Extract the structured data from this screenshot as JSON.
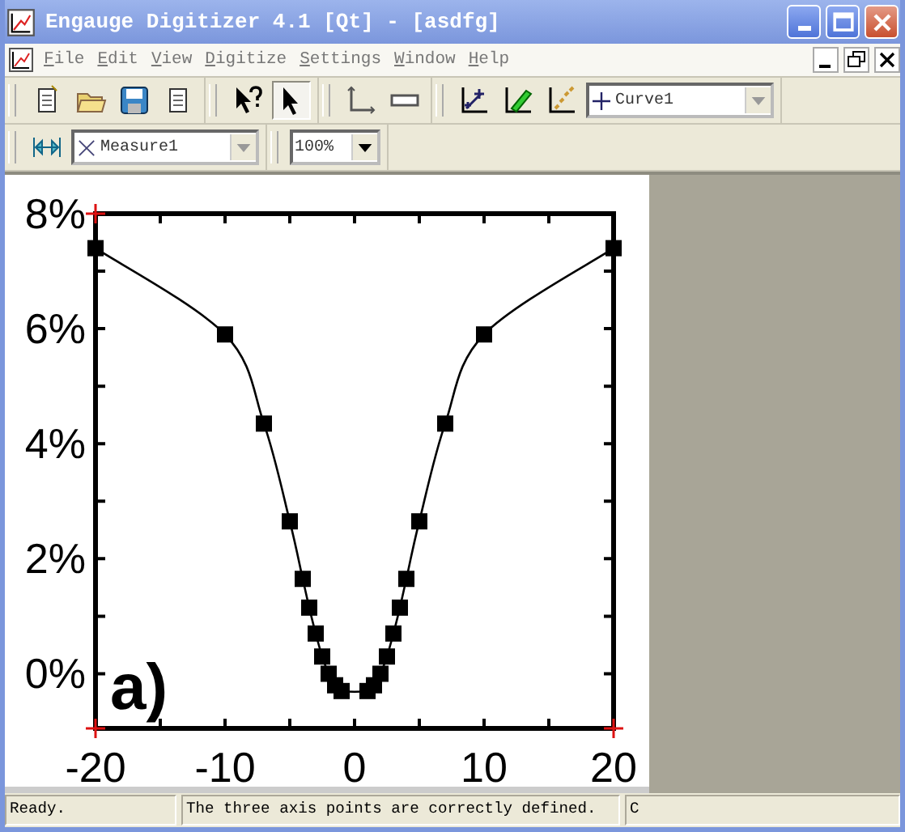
{
  "window": {
    "title": "Engauge Digitizer 4.1 [Qt] - [asdfg]"
  },
  "menu": [
    {
      "label": "File"
    },
    {
      "label": "Edit"
    },
    {
      "label": "View"
    },
    {
      "label": "Digitize"
    },
    {
      "label": "Settings"
    },
    {
      "label": "Window"
    },
    {
      "label": "Help"
    }
  ],
  "toolbar_1": [
    {
      "group": [
        {
          "kind": "new"
        },
        {
          "kind": "open"
        },
        {
          "kind": "save"
        },
        {
          "kind": "properties"
        }
      ]
    },
    {
      "group": [
        {
          "kind": "whats_this"
        },
        {
          "kind": "select",
          "selected": true
        }
      ]
    },
    {
      "group": [
        {
          "kind": "axis",
          "selected": false
        },
        {
          "kind": "scale",
          "selected": false
        }
      ]
    },
    {
      "group": [
        {
          "kind": "point",
          "selected": false
        },
        {
          "kind": "segment",
          "selected": false
        },
        {
          "kind": "match",
          "selected": false
        },
        {
          "kind": "curve_combo",
          "value": "Curve1"
        }
      ]
    }
  ],
  "toolbar_2": [
    {
      "group": [
        {
          "kind": "measure",
          "selected": false
        },
        {
          "kind": "measure_combo",
          "value": "Measure1"
        }
      ]
    },
    {
      "group": [
        {
          "kind": "zoom_combo",
          "value": "100%"
        }
      ]
    }
  ],
  "document": {
    "panel_label": "a)",
    "chart_data": {
      "type": "line",
      "x": [
        -20,
        -10,
        -7,
        -5,
        -4,
        -3.5,
        -3,
        -2.5,
        -2,
        -1.5,
        -1,
        1,
        1.5,
        2,
        2.5,
        3,
        3.5,
        4,
        5,
        7,
        10,
        20
      ],
      "series": [
        {
          "color": "#000000",
          "marker": "square",
          "values": [
            7.4,
            5.9,
            4.35,
            2.65,
            1.65,
            1.15,
            0.7,
            0.3,
            0,
            -0.2,
            -0.3,
            -0.3,
            -0.2,
            0,
            0.3,
            0.7,
            1.15,
            1.65,
            2.65,
            4.35,
            5.9,
            7.4
          ]
        }
      ],
      "xlim": [
        -20,
        20
      ],
      "ylim": [
        -0.95,
        8
      ],
      "xticks": [
        -20,
        -10,
        0,
        10,
        20
      ],
      "yticks": [
        {
          "value": 0,
          "label": "0%"
        },
        {
          "value": 2,
          "label": "2%"
        },
        {
          "value": 4,
          "label": "4%"
        },
        {
          "value": 6,
          "label": "6%"
        },
        {
          "value": 8,
          "label": "8%"
        }
      ]
    }
  },
  "status_bar": [
    "Ready.",
    "The three axis points are correctly defined.",
    "C"
  ]
}
